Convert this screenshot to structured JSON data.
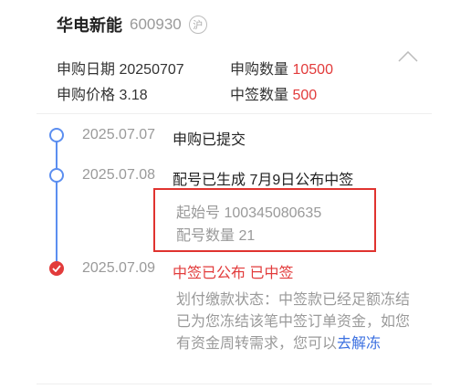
{
  "stock": {
    "name": "华电新能",
    "code": "600930",
    "market_badge": "沪"
  },
  "summary": {
    "subscribe_date_label": "申购日期",
    "subscribe_date": "20250707",
    "subscribe_qty_label": "申购数量",
    "subscribe_qty": "10500",
    "price_label": "申购价格",
    "price": "3.18",
    "won_qty_label": "中签数量",
    "won_qty": "500"
  },
  "timeline": [
    {
      "date": "2025.07.07",
      "status": "申购已提交"
    },
    {
      "date": "2025.07.08",
      "status": "配号已生成 7月9日公布中签",
      "details": [
        "起始号 100345080635",
        "配号数量 21"
      ]
    },
    {
      "date": "2025.07.09",
      "status": "中签已公布 已中签"
    }
  ],
  "payment_note": {
    "line1": "划付缴款状态：中签款已经足额冻结",
    "line2": "已为您冻结该笔中签订单资金，如您有资金周转需求，您可以",
    "link": "去解冻"
  },
  "colors": {
    "accent_blue": "#5b8ef0",
    "accent_red": "#e23b3b",
    "highlight_border": "#e0332f"
  },
  "icons": {
    "collapse": "chevron-up-icon",
    "done_node": "checkmark-icon"
  }
}
